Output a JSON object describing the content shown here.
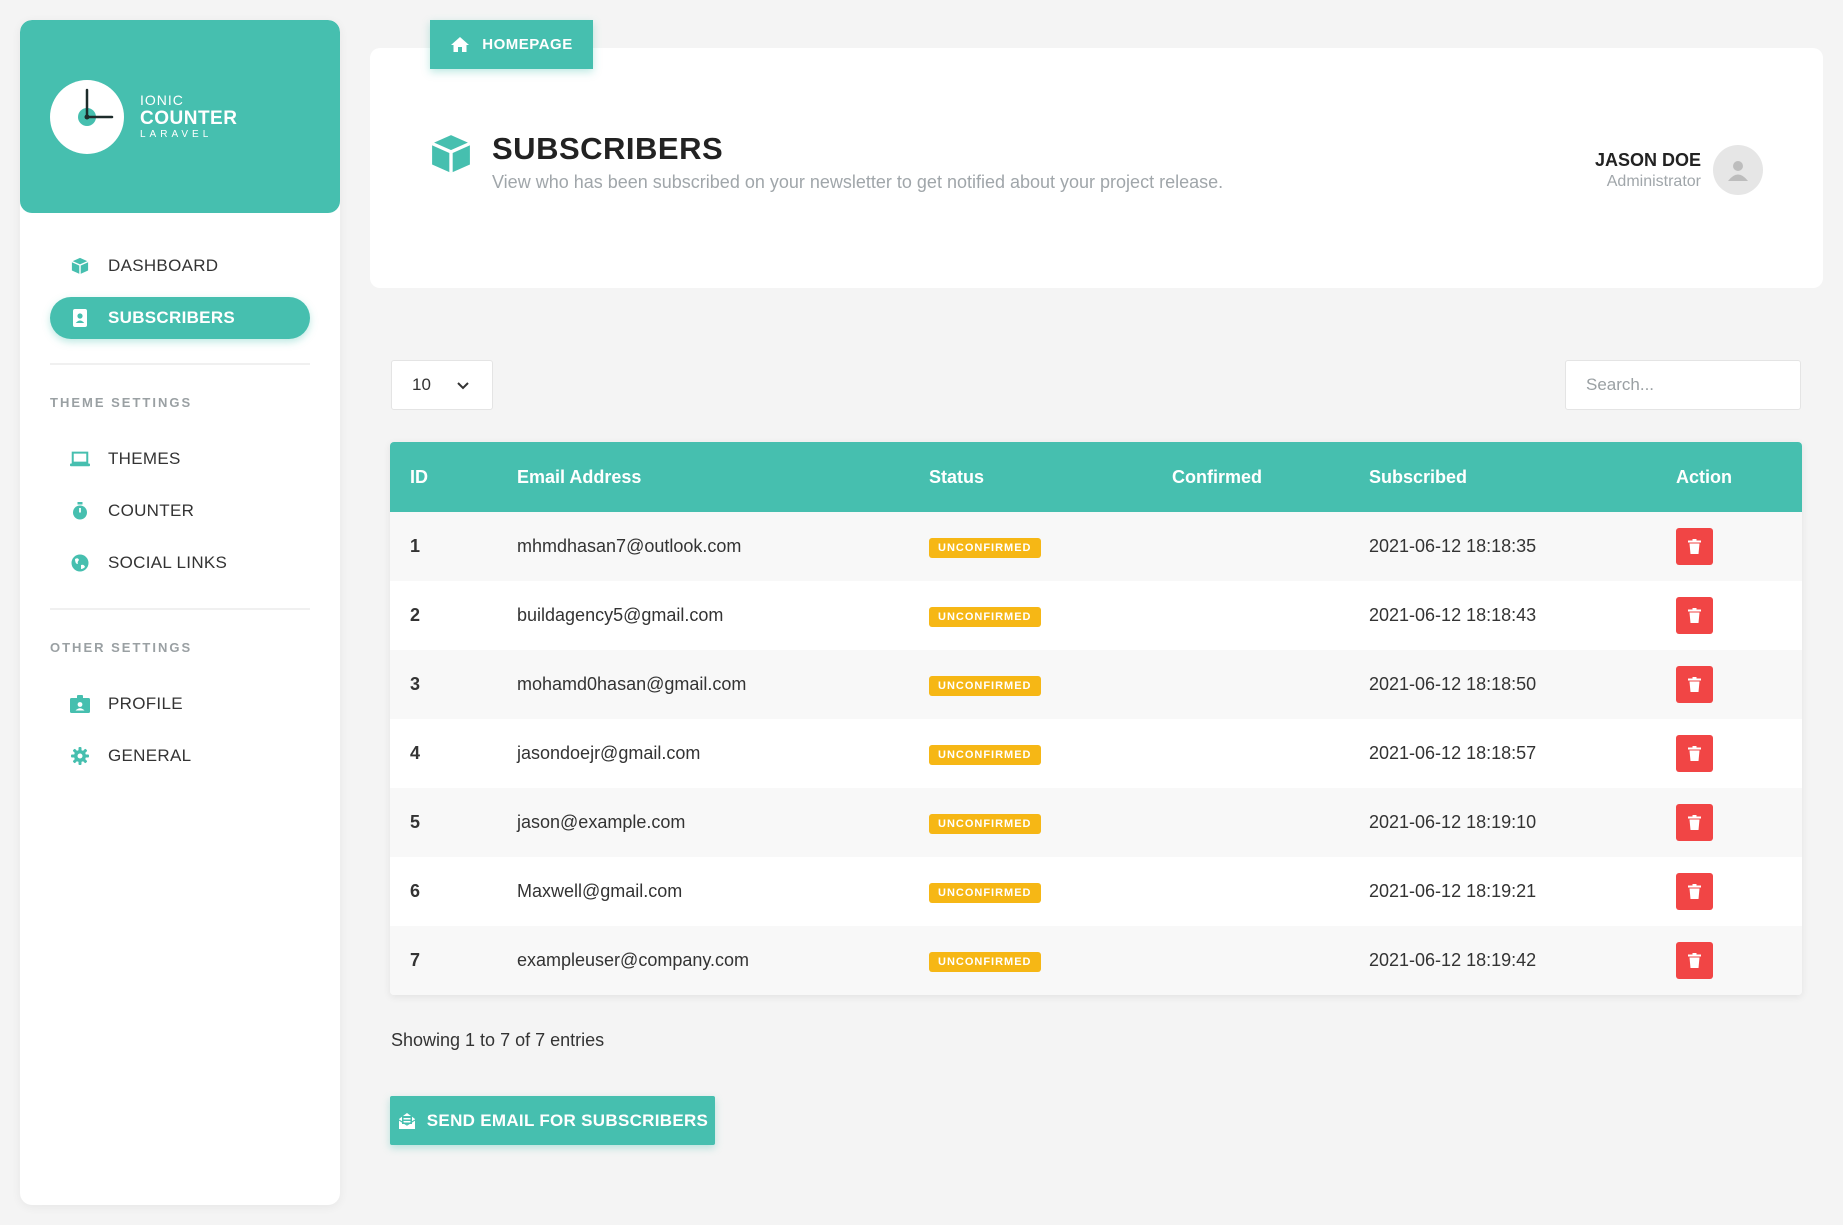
{
  "brand": {
    "line1": "IONIC",
    "line2": "COUNTER",
    "line3": "LARAVEL"
  },
  "sidebar": {
    "items": [
      {
        "label": "DASHBOARD",
        "icon": "cube-icon"
      },
      {
        "label": "SUBSCRIBERS",
        "icon": "address-book-icon",
        "active": true
      }
    ],
    "theme_section": "THEME SETTINGS",
    "theme_items": [
      {
        "label": "THEMES",
        "icon": "laptop-icon"
      },
      {
        "label": "COUNTER",
        "icon": "stopwatch-icon"
      },
      {
        "label": "SOCIAL LINKS",
        "icon": "globe-icon"
      }
    ],
    "other_section": "OTHER SETTINGS",
    "other_items": [
      {
        "label": "PROFILE",
        "icon": "id-badge-icon"
      },
      {
        "label": "GENERAL",
        "icon": "gear-icon"
      }
    ]
  },
  "header": {
    "home_button": "HOMEPAGE",
    "title": "SUBSCRIBERS",
    "subtitle": "View who has been subscribed on your newsletter to get notified about your project release.",
    "user_name": "JASON DOE",
    "user_role": "Administrator"
  },
  "controls": {
    "page_length": "10",
    "search_placeholder": "Search..."
  },
  "table": {
    "columns": [
      "ID",
      "Email Address",
      "Status",
      "Confirmed",
      "Subscribed",
      "Action"
    ],
    "rows": [
      {
        "id": "1",
        "email": "mhmdhasan7@outlook.com",
        "status": "UNCONFIRMED",
        "confirmed": "",
        "subscribed": "2021-06-12 18:18:35"
      },
      {
        "id": "2",
        "email": "buildagency5@gmail.com",
        "status": "UNCONFIRMED",
        "confirmed": "",
        "subscribed": "2021-06-12 18:18:43"
      },
      {
        "id": "3",
        "email": "mohamd0hasan@gmail.com",
        "status": "UNCONFIRMED",
        "confirmed": "",
        "subscribed": "2021-06-12 18:18:50"
      },
      {
        "id": "4",
        "email": "jasondoejr@gmail.com",
        "status": "UNCONFIRMED",
        "confirmed": "",
        "subscribed": "2021-06-12 18:18:57"
      },
      {
        "id": "5",
        "email": "jason@example.com",
        "status": "UNCONFIRMED",
        "confirmed": "",
        "subscribed": "2021-06-12 18:19:10"
      },
      {
        "id": "6",
        "email": "Maxwell@gmail.com",
        "status": "UNCONFIRMED",
        "confirmed": "",
        "subscribed": "2021-06-12 18:19:21"
      },
      {
        "id": "7",
        "email": "exampleuser@company.com",
        "status": "UNCONFIRMED",
        "confirmed": "",
        "subscribed": "2021-06-12 18:19:42"
      }
    ]
  },
  "footer": {
    "info": "Showing 1 to 7 of 7 entries",
    "send_button": "SEND EMAIL FOR SUBSCRIBERS"
  },
  "colors": {
    "accent": "#46bfaf",
    "badge": "#f6b715",
    "danger": "#f14545"
  }
}
